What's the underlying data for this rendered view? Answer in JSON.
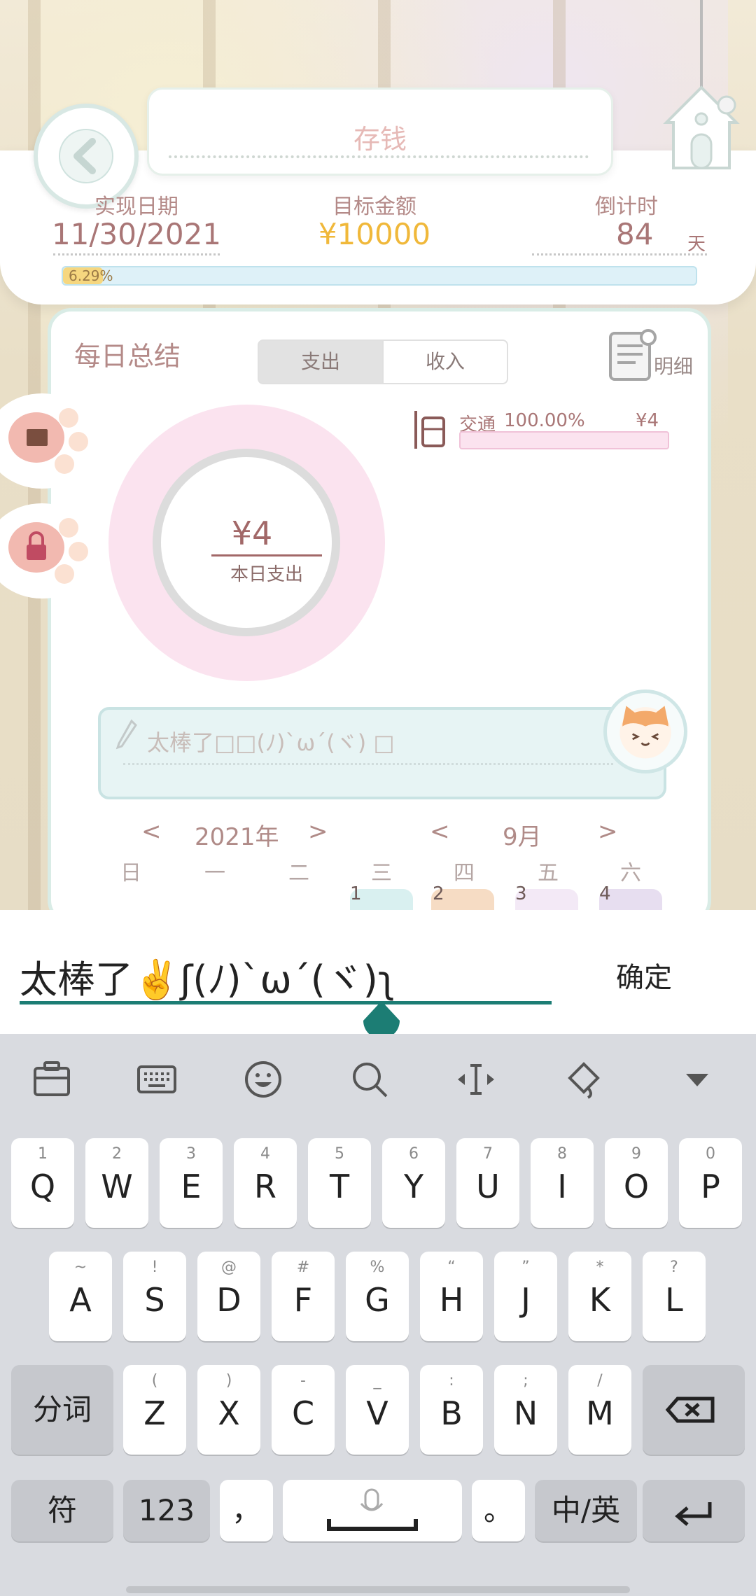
{
  "header": {
    "title": "存钱",
    "stats": [
      {
        "label": "实现日期",
        "value": "11/30/2021",
        "color": "#a97676"
      },
      {
        "label": "目标金额",
        "value": "¥10000",
        "color": "#f0b83a"
      },
      {
        "label": "倒计时",
        "value": "84",
        "unit": "天",
        "color": "#a97676"
      }
    ],
    "progress": {
      "label": "6.29%",
      "fraction": 0.0629
    }
  },
  "summary": {
    "title": "每日总结",
    "tabs": [
      "支出",
      "收入"
    ],
    "active_tab": "支出",
    "detail_label": "明细",
    "total_amount": "¥4",
    "total_label": "本日支出",
    "categories": [
      {
        "name": "交通",
        "percent": "100.00%",
        "amount": "¥4"
      }
    ]
  },
  "note": {
    "placeholder": "太棒了□□(ﾉ)`ω´(ヾ) □"
  },
  "calendar": {
    "year_label": "2021年",
    "month_label": "9月",
    "prev": "<",
    "next": ">",
    "weekdays": [
      "日",
      "一",
      "二",
      "三",
      "四",
      "五",
      "六"
    ],
    "days": [
      "1",
      "2",
      "3",
      "4"
    ]
  },
  "input": {
    "value": "太棒了✌️ʃ(ﾉ)`ω´(ヾ)ʅ",
    "confirm": "确定"
  },
  "keyboard": {
    "toolbar": [
      "clipboard-icon",
      "keyboard-icon",
      "emoji-icon",
      "search-icon",
      "cursor-move-icon",
      "skin-icon",
      "collapse-icon"
    ],
    "row1": [
      {
        "hint": "1",
        "key": "Q"
      },
      {
        "hint": "2",
        "key": "W"
      },
      {
        "hint": "3",
        "key": "E"
      },
      {
        "hint": "4",
        "key": "R"
      },
      {
        "hint": "5",
        "key": "T"
      },
      {
        "hint": "6",
        "key": "Y"
      },
      {
        "hint": "7",
        "key": "U"
      },
      {
        "hint": "8",
        "key": "I"
      },
      {
        "hint": "9",
        "key": "O"
      },
      {
        "hint": "0",
        "key": "P"
      }
    ],
    "row2": [
      {
        "hint": "~",
        "key": "A"
      },
      {
        "hint": "!",
        "key": "S"
      },
      {
        "hint": "@",
        "key": "D"
      },
      {
        "hint": "#",
        "key": "F"
      },
      {
        "hint": "%",
        "key": "G"
      },
      {
        "hint": "“",
        "key": "H"
      },
      {
        "hint": "”",
        "key": "J"
      },
      {
        "hint": "*",
        "key": "K"
      },
      {
        "hint": "?",
        "key": "L"
      }
    ],
    "row3": [
      {
        "hint": "(",
        "key": "Z"
      },
      {
        "hint": ")",
        "key": "X"
      },
      {
        "hint": "-",
        "key": "C"
      },
      {
        "hint": "_",
        "key": "V"
      },
      {
        "hint": ":",
        "key": "B"
      },
      {
        "hint": ";",
        "key": "N"
      },
      {
        "hint": "/",
        "key": "M"
      }
    ],
    "segment_key": "分词",
    "symbol_key": "符",
    "number_key": "123",
    "comma_key": "，",
    "period_key": "。",
    "lang_key": "中/英"
  }
}
